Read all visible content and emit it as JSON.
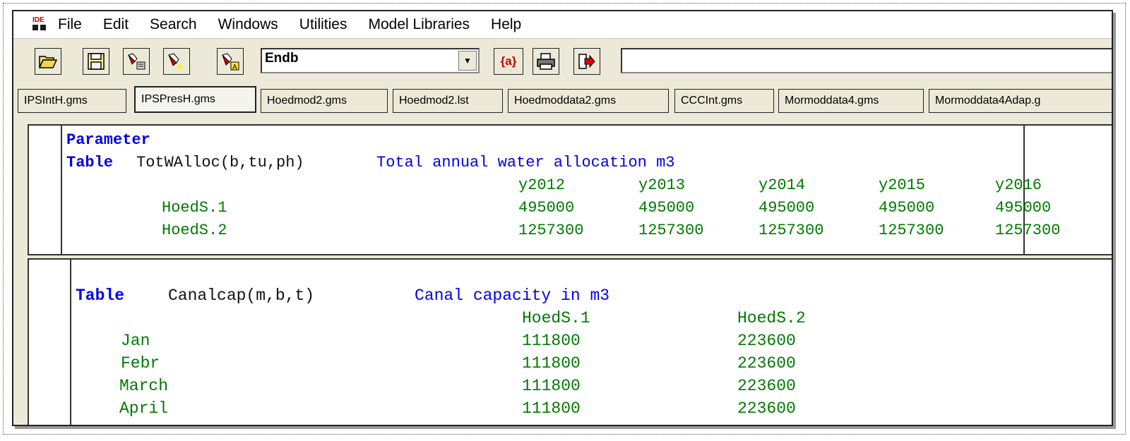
{
  "app": {
    "icon_text": "IDE",
    "menu": [
      "File",
      "Edit",
      "Search",
      "Windows",
      "Utilities",
      "Model Libraries",
      "Help"
    ]
  },
  "toolbar": {
    "combo_value": "Endb",
    "macro_button_label": "{a}"
  },
  "tabs": [
    "IPSIntH.gms",
    "IPSPresH.gms",
    "Hoedmod2.gms",
    "Hoedmod2.lst",
    "Hoedmoddata2.gms",
    "CCCInt.gms",
    "Mormoddata4.gms",
    "Mormoddata4Adap.g"
  ],
  "editor1": {
    "line1": "Parameter",
    "line2_kw": "Table",
    "line2_name": "TotWAlloc(b,tu,ph)",
    "line2_desc": "Total annual water allocation m3",
    "headers": [
      "y2012",
      "y2013",
      "y2014",
      "y2015",
      "y2016"
    ],
    "rows": [
      {
        "label": "HoedS.1",
        "values": [
          "495000",
          "495000",
          "495000",
          "495000",
          "495000"
        ]
      },
      {
        "label": "HoedS.2",
        "values": [
          "1257300",
          "1257300",
          "1257300",
          "1257300",
          "1257300"
        ]
      }
    ]
  },
  "editor2": {
    "line1_kw": "Table",
    "line1_name": "Canalcap(m,b,t)",
    "line1_desc": "Canal capacity in m3",
    "headers": [
      "HoedS.1",
      "HoedS.2"
    ],
    "rows": [
      {
        "label": "Jan",
        "values": [
          "111800",
          "223600"
        ]
      },
      {
        "label": "Febr",
        "values": [
          "111800",
          "223600"
        ]
      },
      {
        "label": "March",
        "values": [
          "111800",
          "223600"
        ]
      },
      {
        "label": "April",
        "values": [
          "111800",
          "223600"
        ]
      }
    ]
  }
}
